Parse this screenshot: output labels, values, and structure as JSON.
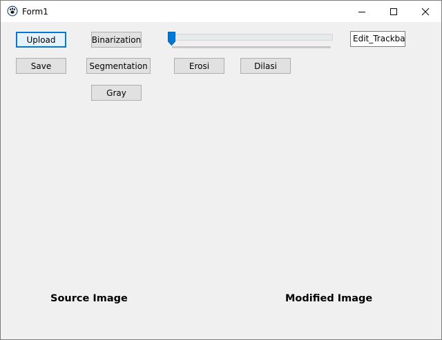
{
  "window": {
    "title": "Form1"
  },
  "toolbar": {
    "upload_label": "Upload",
    "save_label": "Save",
    "binarization_label": "Binarization",
    "segmentation_label": "Segmentation",
    "gray_label": "Gray",
    "erosi_label": "Erosi",
    "dilasi_label": "Dilasi"
  },
  "trackbar": {
    "value_fraction": 0
  },
  "edit_trackbar": {
    "value": "Edit_Trackbar"
  },
  "captions": {
    "source": "Source Image",
    "modified": "Modified Image"
  },
  "colors": {
    "accent": "#0078d7",
    "client_bg": "#f0f0f0",
    "button_bg": "#e1e1e1",
    "button_border": "#adadad"
  },
  "icons": {
    "app": "paw-icon",
    "minimize": "minimize-icon",
    "maximize": "maximize-icon",
    "close": "close-icon"
  }
}
